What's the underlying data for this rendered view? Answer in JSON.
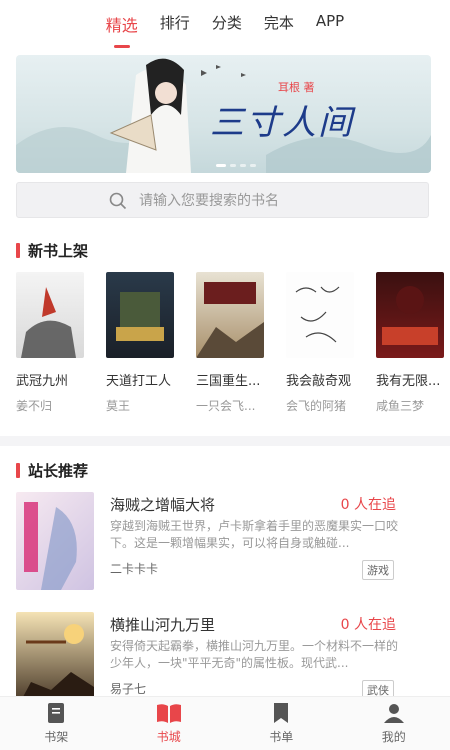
{
  "top_tabs": [
    {
      "label": "精选",
      "active": true
    },
    {
      "label": "排行",
      "active": false
    },
    {
      "label": "分类",
      "active": false
    },
    {
      "label": "完本",
      "active": false
    },
    {
      "label": "APP",
      "active": false
    }
  ],
  "banner": {
    "subtitle": "耳根 著",
    "title": "三寸人间"
  },
  "search": {
    "placeholder": "请输入您要搜索的书名"
  },
  "new_books": {
    "title": "新书上架",
    "items": [
      {
        "name": "武冠九州",
        "author": "姜不归"
      },
      {
        "name": "天道打工人",
        "author": "莫王"
      },
      {
        "name": "三国重生...",
        "author": "一只会飞..."
      },
      {
        "name": "我会敲奇观",
        "author": "会飞的阿猪"
      },
      {
        "name": "我有无限...",
        "author": "咸鱼三梦"
      }
    ]
  },
  "recommend": {
    "title": "站长推荐",
    "items": [
      {
        "name": "海贼之增幅大将",
        "readers": "0 人在追",
        "desc": "穿越到海贼王世界，卢卡斯拿着手里的恶魔果实一口咬下。这是一颗增幅果实，可以将自身或触碰...",
        "author": "二卡卡卡",
        "tag": "游戏"
      },
      {
        "name": "横推山河九万里",
        "readers": "0 人在追",
        "desc": "安得倚天起霸拳，横推山河九万里。一个材料不一样的少年人，一块\"平平无奇\"的属性板。现代武...",
        "author": "易子七",
        "tag": "武侠"
      }
    ]
  },
  "bottom_nav": [
    {
      "label": "书架",
      "active": false
    },
    {
      "label": "书城",
      "active": true
    },
    {
      "label": "书单",
      "active": false
    },
    {
      "label": "我的",
      "active": false
    }
  ],
  "colors": {
    "accent": "#e8464a"
  }
}
